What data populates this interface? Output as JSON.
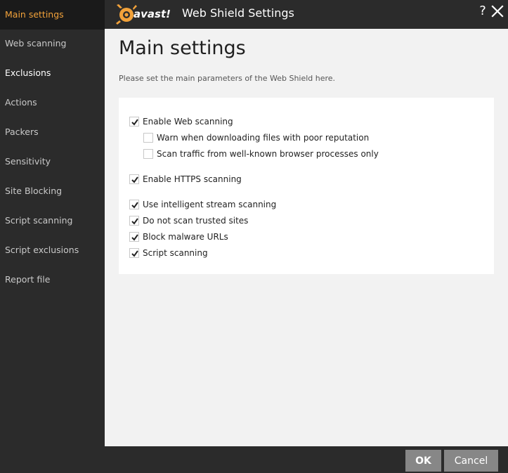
{
  "window": {
    "title": "Web Shield Settings",
    "brand": "avast!"
  },
  "colors": {
    "accent": "#f2a23a",
    "sidebar_bg": "#2b2b2b",
    "content_bg": "#f2f2f2",
    "button_bg": "#878787"
  },
  "sidebar": {
    "items": [
      {
        "label": "Main settings",
        "active": true
      },
      {
        "label": "Web scanning"
      },
      {
        "label": "Exclusions"
      },
      {
        "label": "Actions"
      },
      {
        "label": "Packers"
      },
      {
        "label": "Sensitivity"
      },
      {
        "label": "Site Blocking"
      },
      {
        "label": "Script scanning"
      },
      {
        "label": "Script exclusions"
      },
      {
        "label": "Report file"
      }
    ]
  },
  "main": {
    "heading": "Main settings",
    "description": "Please set the main parameters of the Web Shield here.",
    "options": [
      {
        "label": "Enable Web scanning",
        "checked": true
      },
      {
        "label": "Warn when downloading files with poor reputation",
        "checked": false
      },
      {
        "label": "Scan traffic from well-known browser processes only",
        "checked": false
      },
      {
        "label": "Enable HTTPS scanning",
        "checked": true
      },
      {
        "label": "Use intelligent stream scanning",
        "checked": true
      },
      {
        "label": "Do not scan trusted sites",
        "checked": true
      },
      {
        "label": "Block malware URLs",
        "checked": true
      },
      {
        "label": "Script scanning",
        "checked": true
      }
    ]
  },
  "footer": {
    "ok_label": "OK",
    "cancel_label": "Cancel"
  }
}
